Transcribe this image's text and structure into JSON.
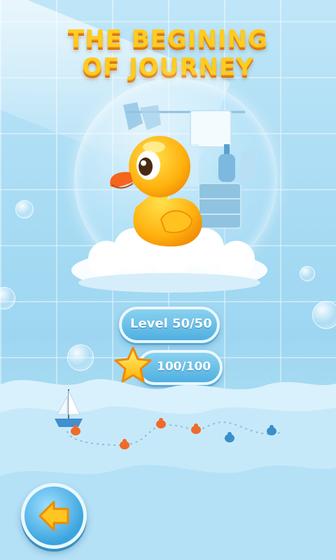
{
  "title": {
    "line1": "THE BEGINING",
    "line2": "OF JOURNEY"
  },
  "level": {
    "label": "Level 50/50"
  },
  "stars": {
    "label": "100/100"
  },
  "icons": {
    "back": "back-arrow-icon",
    "star": "star-icon",
    "duck": "rubber-duck-icon",
    "boat": "sailboat-icon",
    "markers": "level-marker-icon"
  },
  "colors": {
    "title": "#ffcc1f",
    "title_outline": "#f18b12",
    "pill": "#4fb0e0",
    "duck": "#ffb20f",
    "star": "#ffd21f"
  }
}
